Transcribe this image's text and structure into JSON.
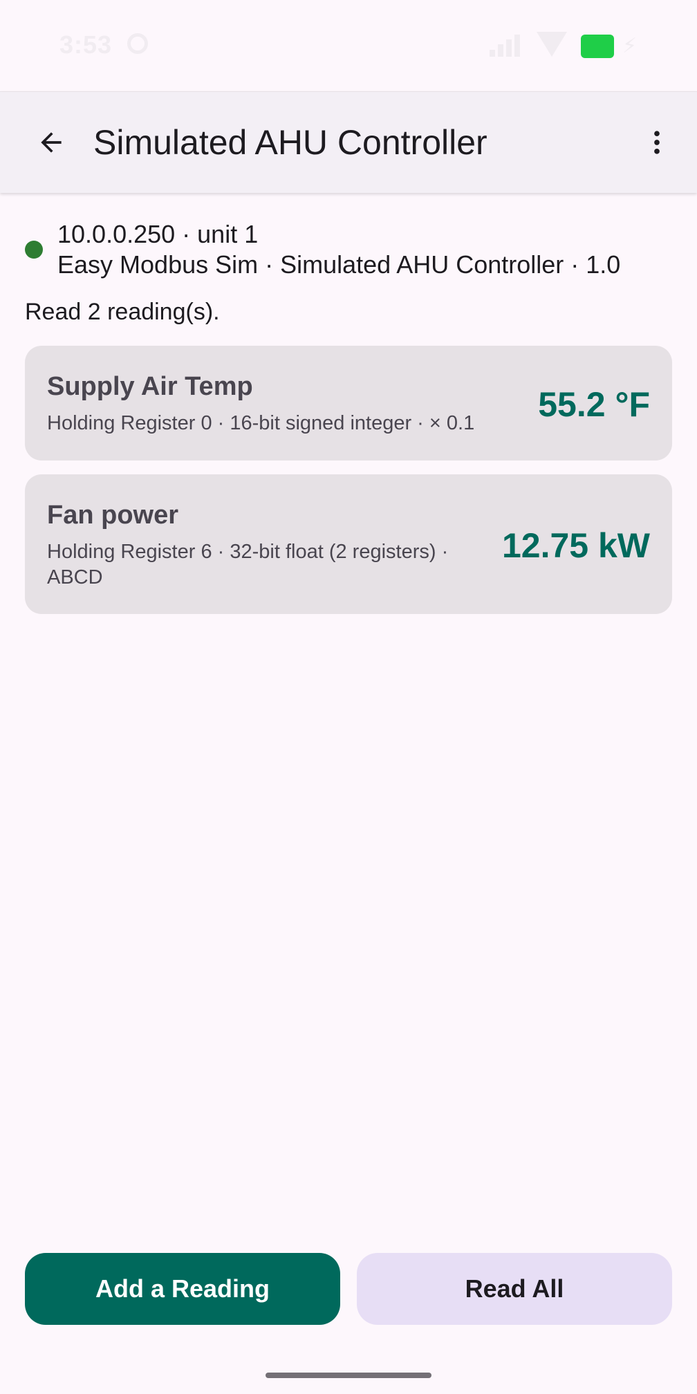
{
  "status_bar": {
    "time": "3:53"
  },
  "app_bar": {
    "title": "Simulated AHU Controller",
    "back_icon": "arrow-back-icon",
    "menu_icon": "more-vert-icon"
  },
  "connection": {
    "status_color": "#2e7d32",
    "address_line": "10.0.0.250 · unit 1",
    "device_line": "Easy Modbus Sim · Simulated AHU Controller · 1.0"
  },
  "summary": "Read 2 reading(s).",
  "readings": [
    {
      "name": "Supply Air Temp",
      "description": "Holding Register 0 · 16-bit signed integer · × 0.1",
      "value": "55.2 °F"
    },
    {
      "name": "Fan power",
      "description": "Holding Register 6 · 32-bit float (2 registers) · ABCD",
      "value": "12.75 kW"
    }
  ],
  "actions": {
    "add_label": "Add a Reading",
    "read_all_label": "Read All"
  },
  "colors": {
    "accent": "#00695c",
    "value_text": "#00695c",
    "secondary_button": "#e7def5",
    "card_background": "#e6e1e5",
    "battery": "#1fce48"
  }
}
